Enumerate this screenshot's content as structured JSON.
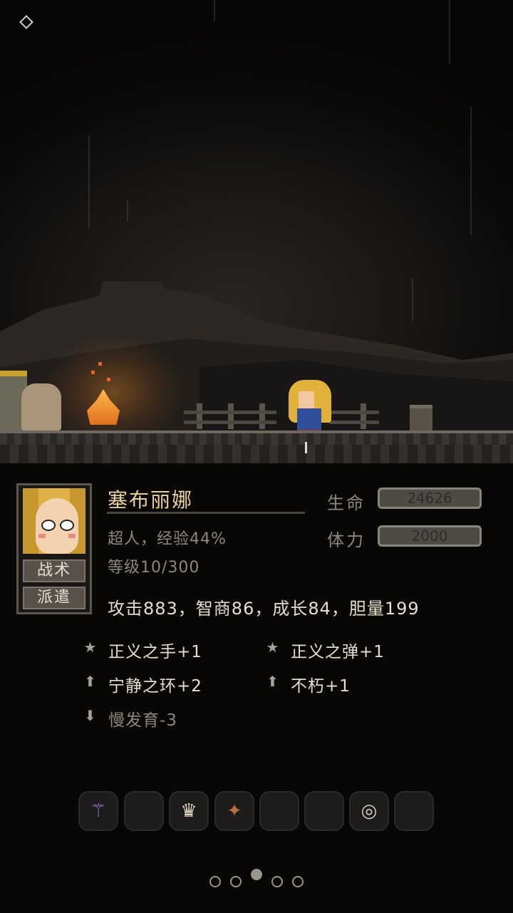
{
  "character": {
    "name": "塞布丽娜",
    "class_exp": "超人，经验44%",
    "level": "等级10/300",
    "hp_label": "生命",
    "hp_value": "24626",
    "stamina_label": "体力",
    "stamina_value": "2000",
    "attributes": "攻击883，智商86，成长84，胆量199"
  },
  "portrait_buttons": {
    "tactics": "战术",
    "dispatch": "派遣"
  },
  "traits": [
    {
      "label": "正义之手+1",
      "icon": "star-icon",
      "glyph": "★"
    },
    {
      "label": "正义之弹+1",
      "icon": "star-icon",
      "glyph": "★"
    },
    {
      "label": "宁静之环+2",
      "icon": "arrow-up-icon",
      "glyph": "⬆"
    },
    {
      "label": "不朽+1",
      "icon": "arrow-up-icon",
      "glyph": "⬆"
    },
    {
      "label": "慢发育-3",
      "icon": "arrow-down-icon",
      "glyph": "⬇"
    }
  ],
  "equipment_slots": [
    {
      "icon": "staff-icon",
      "glyph": "⚚",
      "active": true
    },
    {
      "icon": "empty-slot-icon",
      "glyph": "",
      "active": false
    },
    {
      "icon": "armor-icon",
      "glyph": "♛",
      "active": true
    },
    {
      "icon": "boot-icon",
      "glyph": "✦",
      "active": true
    },
    {
      "icon": "empty-slot-icon",
      "glyph": "",
      "active": false
    },
    {
      "icon": "empty-slot-icon",
      "glyph": "",
      "active": false
    },
    {
      "icon": "ring-icon",
      "glyph": "◎",
      "active": true
    },
    {
      "icon": "empty-slot-icon",
      "glyph": "",
      "active": false
    }
  ],
  "pager": {
    "count": 5,
    "active_index": 2
  },
  "colors": {
    "name": "#e8d29a",
    "text": "#e6dece",
    "muted": "#8e877c",
    "fire": "#ffb84a"
  }
}
